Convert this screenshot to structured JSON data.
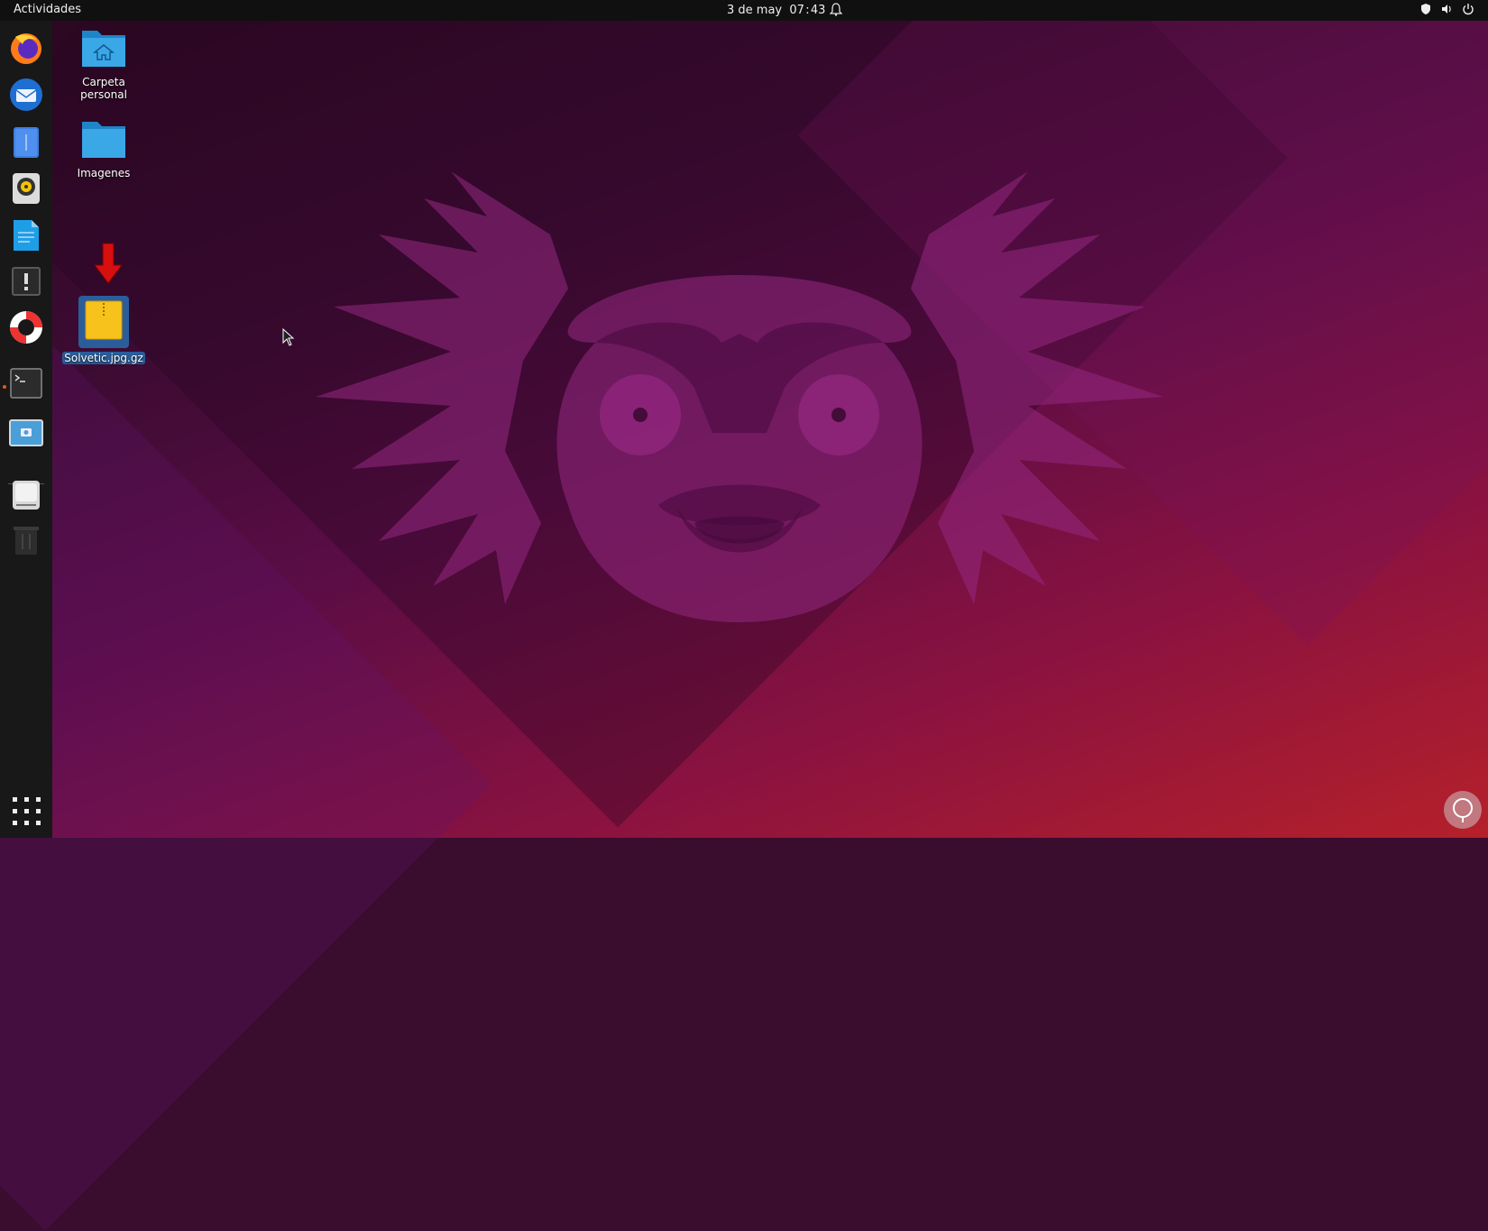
{
  "topbar": {
    "activities": "Actividades",
    "date": "3 de may",
    "time": "07 : 43"
  },
  "dock": {
    "items": [
      {
        "name": "firefox-icon"
      },
      {
        "name": "thunderbird-icon"
      },
      {
        "name": "files-icon"
      },
      {
        "name": "rhythmbox-icon"
      },
      {
        "name": "writer-icon"
      },
      {
        "name": "software-icon"
      },
      {
        "name": "help-icon"
      },
      {
        "name": "terminal-icon"
      },
      {
        "name": "screenshot-icon"
      },
      {
        "name": "drive-icon"
      },
      {
        "name": "trash-icon"
      }
    ]
  },
  "desktop": {
    "icons": [
      {
        "label": "Carpeta personal"
      },
      {
        "label": "Imagenes"
      },
      {
        "label": "Solvetic.jpg.gz"
      }
    ]
  },
  "colors": {
    "accent": "#e95420",
    "selection": "#2a5d9a",
    "folder": "#3aa0e0"
  }
}
